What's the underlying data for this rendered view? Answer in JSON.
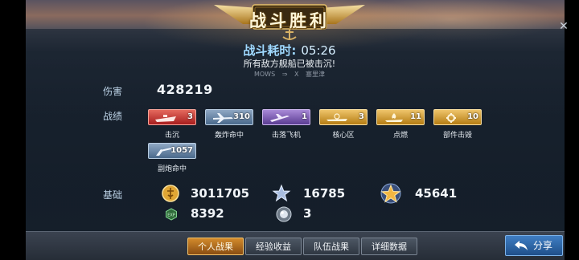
{
  "header": {
    "title": "战斗胜利"
  },
  "summary": {
    "time_label": "战斗耗时:",
    "time_value": "05:26",
    "sunk_message": "所有敌方舰船已被击沉!",
    "player_a": "MOWS",
    "player_b": "X",
    "player_c": "塞里津"
  },
  "damage": {
    "label": "伤害",
    "value": "428219"
  },
  "achievements": {
    "label": "战绩",
    "medals": [
      {
        "name": "击沉",
        "count": "3",
        "color": "#c4322a",
        "icon": "ship-icon"
      },
      {
        "name": "轰炸命中",
        "count": "310",
        "color": "#6d8fb4",
        "icon": "bomber-icon"
      },
      {
        "name": "击落飞机",
        "count": "1",
        "color": "#7b5bb6",
        "icon": "plane-icon"
      },
      {
        "name": "核心区",
        "count": "3",
        "color": "#d8a23a",
        "icon": "core-icon"
      },
      {
        "name": "点燃",
        "count": "11",
        "color": "#d8a23a",
        "icon": "fire-icon"
      },
      {
        "name": "部件击毁",
        "count": "10",
        "color": "#d8a23a",
        "icon": "gear-icon"
      },
      {
        "name": "副炮命中",
        "count": "1057",
        "color": "#6d8fb4",
        "icon": "gun-icon"
      }
    ]
  },
  "basic": {
    "label": "基础",
    "coins": "3011705",
    "exp": "16785",
    "commander_exp": "45641",
    "free_exp": "8392",
    "pearls": "3",
    "free_exp_badge": "EXP"
  },
  "tabs": [
    {
      "label": "个人战果",
      "active": true
    },
    {
      "label": "经验收益",
      "active": false
    },
    {
      "label": "队伍战果",
      "active": false
    },
    {
      "label": "详细数据",
      "active": false
    }
  ],
  "share": {
    "label": "分享"
  },
  "colors": {
    "accent_gold": "#d38b2c",
    "share_blue": "#3f7ec3"
  }
}
